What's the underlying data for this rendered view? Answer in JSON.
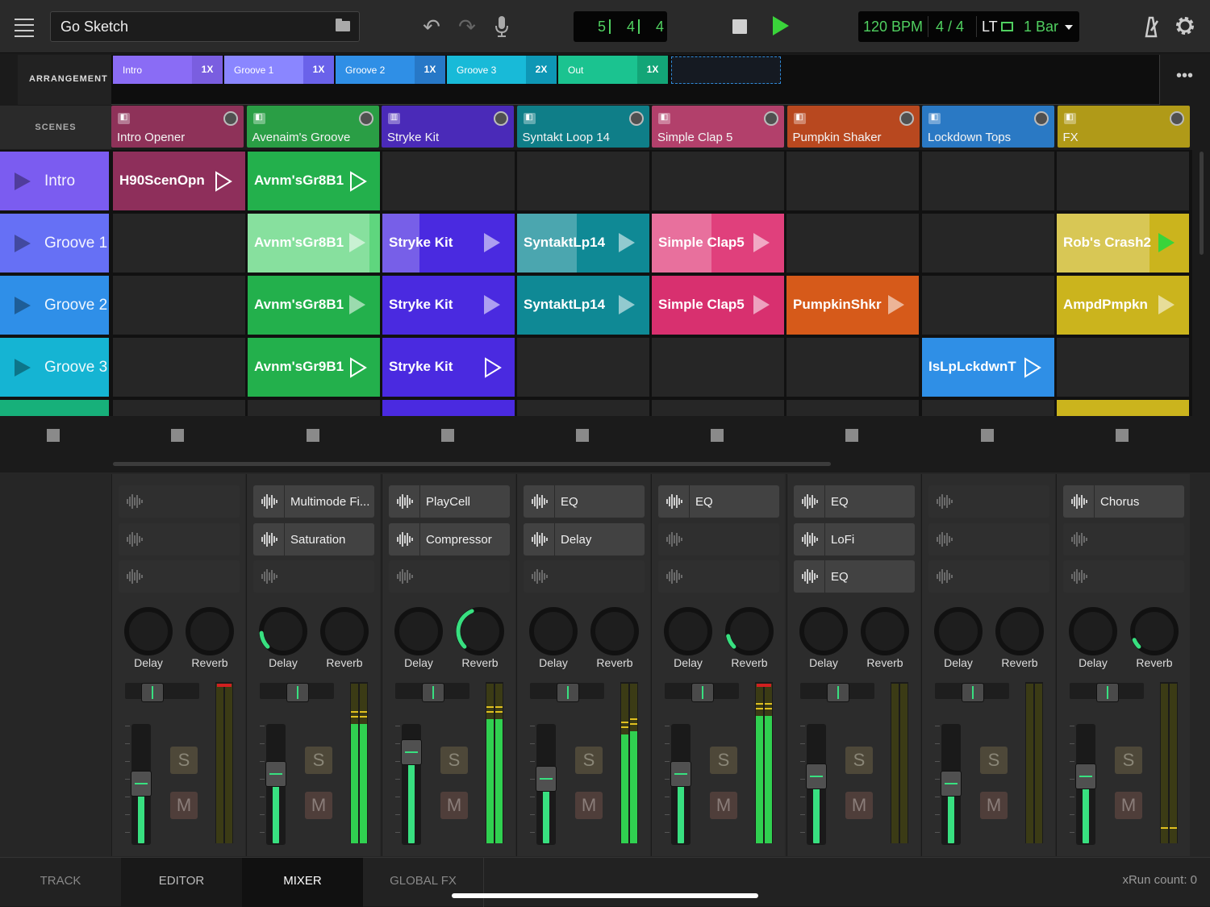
{
  "header": {
    "project_title": "Go Sketch",
    "position": {
      "bars": "5",
      "beats": "4",
      "sixteenths": "4"
    },
    "tempo": "120 BPM",
    "time_signature": "4 / 4",
    "lt_label": "LT",
    "quantize": "1 Bar"
  },
  "arrangement": {
    "label": "ARRANGEMENT",
    "clips": [
      {
        "name": "Intro",
        "repeat": "1X",
        "color": "#8a6cf5"
      },
      {
        "name": "Groove 1",
        "repeat": "1X",
        "color": "#7c7cff"
      },
      {
        "name": "Groove 2",
        "repeat": "1X",
        "color": "#2f8fe6"
      },
      {
        "name": "Groove 3",
        "repeat": "2X",
        "color": "#14b6d8"
      },
      {
        "name": "Out",
        "repeat": "1X",
        "color": "#19c08b"
      }
    ]
  },
  "scenes_label": "SCENES",
  "tracks": [
    {
      "name": "Intro Opener",
      "color": "#8e3259"
    },
    {
      "name": "Avenaim's Groove",
      "color": "#2a9e45"
    },
    {
      "name": "Stryke Kit",
      "color": "#4a2ab8"
    },
    {
      "name": "Syntakt Loop 14",
      "color": "#0f7e88"
    },
    {
      "name": "Simple Clap 5",
      "color": "#b2406b"
    },
    {
      "name": "Pumpkin Shaker",
      "color": "#b8481f"
    },
    {
      "name": "Lockdown Tops",
      "color": "#2a79c4"
    },
    {
      "name": "FX",
      "color": "#b09a18"
    }
  ],
  "scenes": [
    {
      "name": "Intro",
      "color": "#7b5cf0"
    },
    {
      "name": "Groove 1",
      "color": "#6670f5"
    },
    {
      "name": "Groove 2",
      "color": "#2f8fe8"
    },
    {
      "name": "Groove 3",
      "color": "#15b4d3"
    }
  ],
  "clips": {
    "row0": [
      "H90ScenOpn",
      "Avnm'sGr8B1"
    ],
    "row1": [
      "Avnm'sGr8B1",
      "Stryke Kit",
      "SyntaktLp14",
      "Simple Clap5",
      "Rob's Crash2"
    ],
    "row2": [
      "Avnm'sGr8B1",
      "Stryke Kit",
      "SyntaktLp14",
      "Simple Clap5",
      "PumpkinShkr",
      "AmpdPmpkn"
    ],
    "row3": [
      "Avnm'sGr9B1",
      "Stryke Kit",
      "IsLpLckdwnT"
    ]
  },
  "mixer": {
    "strips": [
      {
        "fx": [
          "",
          "",
          ""
        ],
        "send_delay": 0,
        "send_reverb": 0,
        "fader": 0.52,
        "meter_l": 0,
        "meter_r": 0
      },
      {
        "fx": [
          "Multimode Fi...",
          "Saturation",
          ""
        ],
        "send_delay": 0.15,
        "send_reverb": 0,
        "fader": 0.6,
        "meter_l": 0.75,
        "meter_r": 0.75
      },
      {
        "fx": [
          "PlayCell",
          "Compressor",
          ""
        ],
        "send_delay": 0,
        "send_reverb": 0.42,
        "fader": 0.78,
        "meter_l": 0.78,
        "meter_r": 0.78
      },
      {
        "fx": [
          "EQ",
          "Delay",
          ""
        ],
        "send_delay": 0,
        "send_reverb": 0,
        "fader": 0.56,
        "meter_l": 0.68,
        "meter_r": 0.7
      },
      {
        "fx": [
          "EQ",
          "",
          ""
        ],
        "send_delay": 0,
        "send_reverb": 0.12,
        "fader": 0.6,
        "meter_l": 0.8,
        "meter_r": 0.8
      },
      {
        "fx": [
          "EQ",
          "LoFi",
          "EQ"
        ],
        "send_delay": 0,
        "send_reverb": 0,
        "fader": 0.58,
        "meter_l": 0,
        "meter_r": 0
      },
      {
        "fx": [
          "",
          "",
          ""
        ],
        "send_delay": 0,
        "send_reverb": 0,
        "fader": 0.52,
        "meter_l": 0,
        "meter_r": 0
      },
      {
        "fx": [
          "Chorus",
          "",
          ""
        ],
        "send_delay": 0,
        "send_reverb": 0.08,
        "fader": 0.58,
        "meter_l": 0,
        "meter_r": 0
      }
    ],
    "send_labels": {
      "delay": "Delay",
      "reverb": "Reverb"
    },
    "solo_label": "S",
    "mute_label": "M"
  },
  "tabs": [
    "TRACK",
    "EDITOR",
    "MIXER",
    "GLOBAL FX"
  ],
  "active_tab": "MIXER",
  "xrun": "xRun count: 0",
  "icons": [
    "menu-icon",
    "folder-icon",
    "undo-icon",
    "redo-icon",
    "mic-icon",
    "stop-icon",
    "play-icon",
    "dropdown-icon",
    "metronome-icon",
    "gear-icon",
    "more-icon"
  ]
}
